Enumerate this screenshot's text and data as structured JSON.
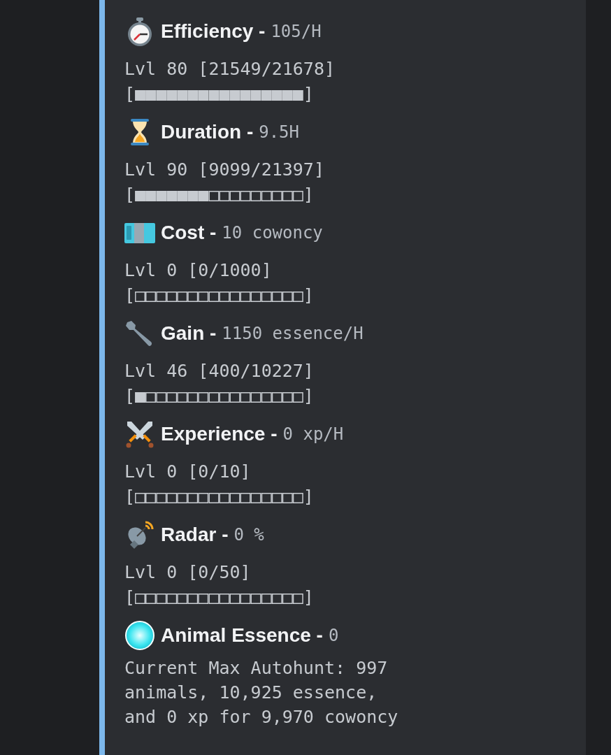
{
  "stats": [
    {
      "name": "Efficiency -",
      "value": "105/H",
      "level_text": "Lvl 80 [21549/21678]",
      "bar": "[■■■■■■■■■■■■■■■■]"
    },
    {
      "name": "Duration -",
      "value": "9.5H",
      "level_text": "Lvl 90 [9099/21397]",
      "bar": "[■■■■■■■□□□□□□□□□]"
    },
    {
      "name": "Cost -",
      "value": "10 cowoncy",
      "level_text": "Lvl 0 [0/1000]",
      "bar": "[□□□□□□□□□□□□□□□□]"
    },
    {
      "name": "Gain -",
      "value": "1150 essence/H",
      "level_text": "Lvl 46 [400/10227]",
      "bar": "[■□□□□□□□□□□□□□□□]"
    },
    {
      "name": "Experience -",
      "value": "0 xp/H",
      "level_text": "Lvl 0 [0/10]",
      "bar": "[□□□□□□□□□□□□□□□□]"
    },
    {
      "name": "Radar -",
      "value": "0 %",
      "level_text": "Lvl 0 [0/50]",
      "bar": "[□□□□□□□□□□□□□□□□]"
    }
  ],
  "essence": {
    "name": "Animal Essence -",
    "value": "0",
    "description": "Current Max Autohunt: 997 animals, 10,925 essence, and 0 xp for 9,970 cowoncy"
  }
}
